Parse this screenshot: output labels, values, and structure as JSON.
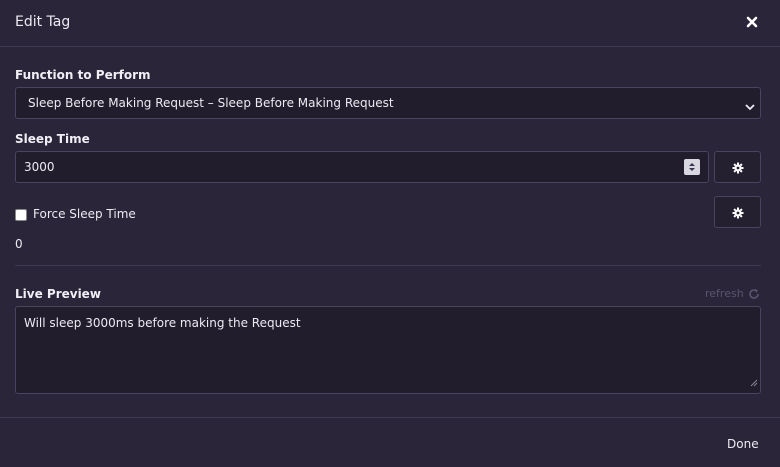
{
  "dialog": {
    "title": "Edit Tag"
  },
  "function_field": {
    "label": "Function to Perform",
    "selected": "Sleep Before Making Request – Sleep Before Making Request"
  },
  "sleep_time": {
    "label": "Sleep Time",
    "value": "3000"
  },
  "force_sleep": {
    "label": "Force Sleep Time",
    "checked": false,
    "value": "0"
  },
  "live_preview": {
    "label": "Live Preview",
    "refresh_label": "refresh",
    "text": "Will sleep 3000ms before making the Request"
  },
  "footer": {
    "done_label": "Done"
  },
  "colors": {
    "background": "#2a2538",
    "input_background": "#211d2d",
    "border": "#4a4460",
    "muted": "#5a5470"
  }
}
